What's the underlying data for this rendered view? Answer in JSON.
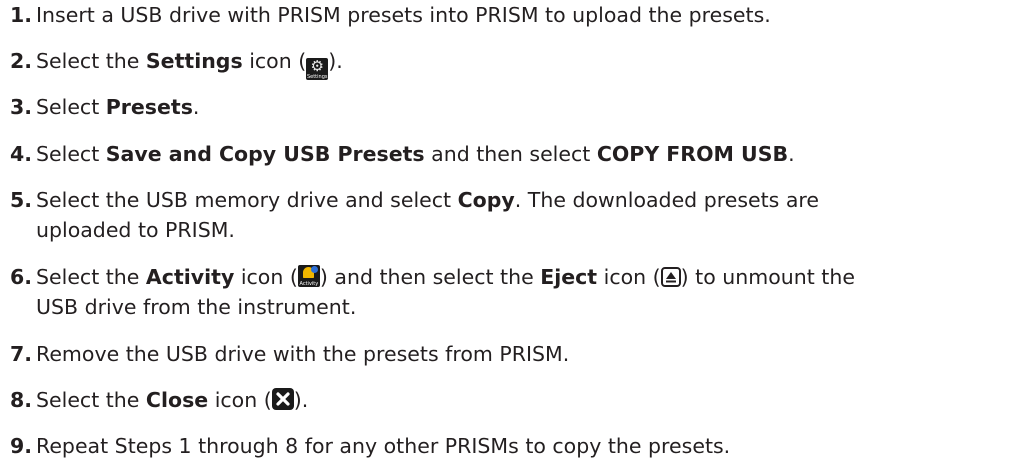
{
  "steps": [
    {
      "num": "1.",
      "parts": [
        {
          "t": "Insert a USB drive with PRISM presets into PRISM to upload the presets.",
          "b": false
        }
      ]
    },
    {
      "num": "2.",
      "parts": [
        {
          "t": "Select the ",
          "b": false
        },
        {
          "t": "Settings",
          "b": true
        },
        {
          "t": " icon (",
          "b": false
        },
        {
          "icon": "settings-icon",
          "caption": "Settings"
        },
        {
          "t": ").",
          "b": false
        }
      ]
    },
    {
      "num": "3.",
      "parts": [
        {
          "t": "Select ",
          "b": false
        },
        {
          "t": "Presets",
          "b": true
        },
        {
          "t": ".",
          "b": false
        }
      ]
    },
    {
      "num": "4.",
      "parts": [
        {
          "t": "Select ",
          "b": false
        },
        {
          "t": "Save and Copy USB Presets",
          "b": true
        },
        {
          "t": " and then select ",
          "b": false
        },
        {
          "t": "COPY FROM USB",
          "b": true
        },
        {
          "t": ".",
          "b": false
        }
      ]
    },
    {
      "num": "5.",
      "parts": [
        {
          "t": "Select the USB memory drive and select ",
          "b": false
        },
        {
          "t": "Copy",
          "b": true
        },
        {
          "t": ". The downloaded presets are",
          "b": false
        }
      ],
      "line2": "uploaded to PRISM."
    },
    {
      "num": "6.",
      "parts": [
        {
          "t": "Select the ",
          "b": false
        },
        {
          "t": "Activity",
          "b": true
        },
        {
          "t": " icon (",
          "b": false
        },
        {
          "icon": "activity-icon",
          "caption": "Activity"
        },
        {
          "t": ") and then select the ",
          "b": false
        },
        {
          "t": "Eject",
          "b": true
        },
        {
          "t": " icon (",
          "b": false
        },
        {
          "icon": "eject-icon"
        },
        {
          "t": ") to unmount the",
          "b": false
        }
      ],
      "line2": "USB drive from the instrument."
    },
    {
      "num": "7.",
      "parts": [
        {
          "t": "Remove the USB drive with the presets from PRISM.",
          "b": false
        }
      ]
    },
    {
      "num": "8.",
      "parts": [
        {
          "t": "Select the ",
          "b": false
        },
        {
          "t": "Close",
          "b": true
        },
        {
          "t": " icon (",
          "b": false
        },
        {
          "icon": "close-icon"
        },
        {
          "t": ").",
          "b": false
        }
      ]
    },
    {
      "num": "9.",
      "parts": [
        {
          "t": "Repeat Steps 1 through 8 for any other PRISMs to copy the presets.",
          "b": false
        }
      ]
    }
  ],
  "colors": {
    "text": "#231f20",
    "icon_dark": "#1a1a1a",
    "bell": "#f2b700"
  }
}
